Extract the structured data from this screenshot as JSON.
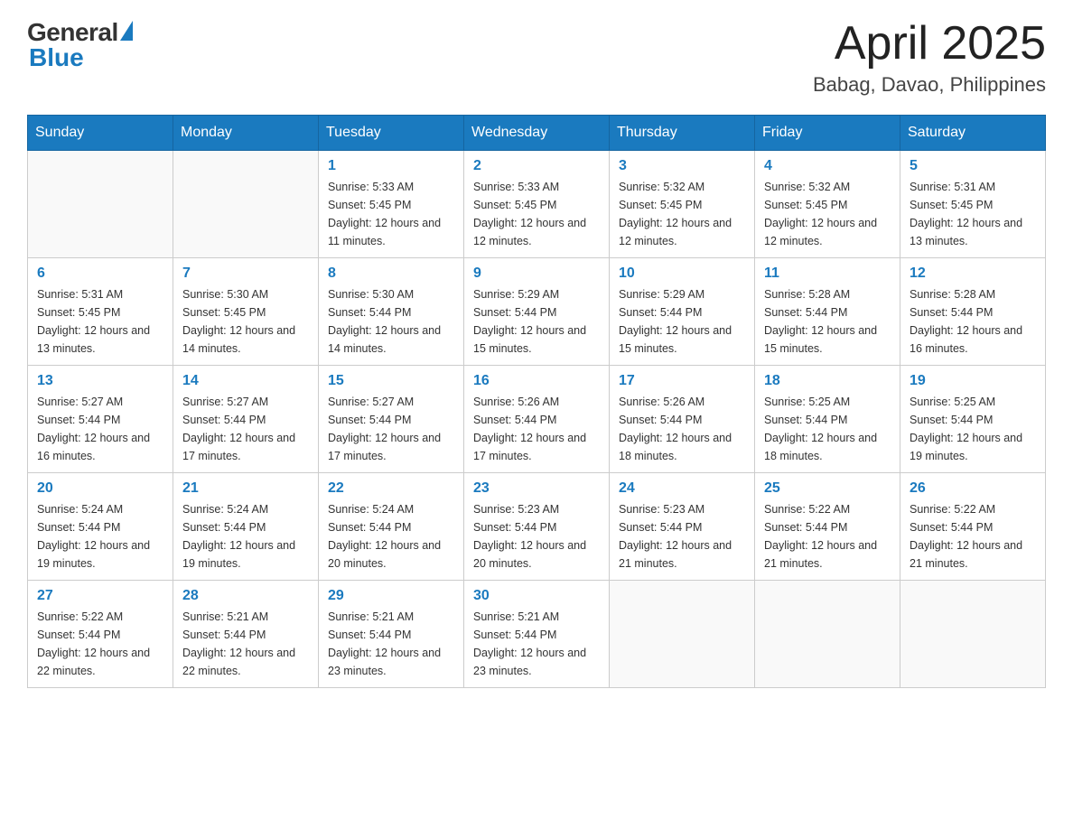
{
  "logo": {
    "general_text": "General",
    "blue_text": "Blue"
  },
  "header": {
    "month_year": "April 2025",
    "location": "Babag, Davao, Philippines"
  },
  "days_of_week": [
    "Sunday",
    "Monday",
    "Tuesday",
    "Wednesday",
    "Thursday",
    "Friday",
    "Saturday"
  ],
  "weeks": [
    [
      {
        "day": "",
        "sunrise": "",
        "sunset": "",
        "daylight": ""
      },
      {
        "day": "",
        "sunrise": "",
        "sunset": "",
        "daylight": ""
      },
      {
        "day": "1",
        "sunrise": "Sunrise: 5:33 AM",
        "sunset": "Sunset: 5:45 PM",
        "daylight": "Daylight: 12 hours and 11 minutes."
      },
      {
        "day": "2",
        "sunrise": "Sunrise: 5:33 AM",
        "sunset": "Sunset: 5:45 PM",
        "daylight": "Daylight: 12 hours and 12 minutes."
      },
      {
        "day": "3",
        "sunrise": "Sunrise: 5:32 AM",
        "sunset": "Sunset: 5:45 PM",
        "daylight": "Daylight: 12 hours and 12 minutes."
      },
      {
        "day": "4",
        "sunrise": "Sunrise: 5:32 AM",
        "sunset": "Sunset: 5:45 PM",
        "daylight": "Daylight: 12 hours and 12 minutes."
      },
      {
        "day": "5",
        "sunrise": "Sunrise: 5:31 AM",
        "sunset": "Sunset: 5:45 PM",
        "daylight": "Daylight: 12 hours and 13 minutes."
      }
    ],
    [
      {
        "day": "6",
        "sunrise": "Sunrise: 5:31 AM",
        "sunset": "Sunset: 5:45 PM",
        "daylight": "Daylight: 12 hours and 13 minutes."
      },
      {
        "day": "7",
        "sunrise": "Sunrise: 5:30 AM",
        "sunset": "Sunset: 5:45 PM",
        "daylight": "Daylight: 12 hours and 14 minutes."
      },
      {
        "day": "8",
        "sunrise": "Sunrise: 5:30 AM",
        "sunset": "Sunset: 5:44 PM",
        "daylight": "Daylight: 12 hours and 14 minutes."
      },
      {
        "day": "9",
        "sunrise": "Sunrise: 5:29 AM",
        "sunset": "Sunset: 5:44 PM",
        "daylight": "Daylight: 12 hours and 15 minutes."
      },
      {
        "day": "10",
        "sunrise": "Sunrise: 5:29 AM",
        "sunset": "Sunset: 5:44 PM",
        "daylight": "Daylight: 12 hours and 15 minutes."
      },
      {
        "day": "11",
        "sunrise": "Sunrise: 5:28 AM",
        "sunset": "Sunset: 5:44 PM",
        "daylight": "Daylight: 12 hours and 15 minutes."
      },
      {
        "day": "12",
        "sunrise": "Sunrise: 5:28 AM",
        "sunset": "Sunset: 5:44 PM",
        "daylight": "Daylight: 12 hours and 16 minutes."
      }
    ],
    [
      {
        "day": "13",
        "sunrise": "Sunrise: 5:27 AM",
        "sunset": "Sunset: 5:44 PM",
        "daylight": "Daylight: 12 hours and 16 minutes."
      },
      {
        "day": "14",
        "sunrise": "Sunrise: 5:27 AM",
        "sunset": "Sunset: 5:44 PM",
        "daylight": "Daylight: 12 hours and 17 minutes."
      },
      {
        "day": "15",
        "sunrise": "Sunrise: 5:27 AM",
        "sunset": "Sunset: 5:44 PM",
        "daylight": "Daylight: 12 hours and 17 minutes."
      },
      {
        "day": "16",
        "sunrise": "Sunrise: 5:26 AM",
        "sunset": "Sunset: 5:44 PM",
        "daylight": "Daylight: 12 hours and 17 minutes."
      },
      {
        "day": "17",
        "sunrise": "Sunrise: 5:26 AM",
        "sunset": "Sunset: 5:44 PM",
        "daylight": "Daylight: 12 hours and 18 minutes."
      },
      {
        "day": "18",
        "sunrise": "Sunrise: 5:25 AM",
        "sunset": "Sunset: 5:44 PM",
        "daylight": "Daylight: 12 hours and 18 minutes."
      },
      {
        "day": "19",
        "sunrise": "Sunrise: 5:25 AM",
        "sunset": "Sunset: 5:44 PM",
        "daylight": "Daylight: 12 hours and 19 minutes."
      }
    ],
    [
      {
        "day": "20",
        "sunrise": "Sunrise: 5:24 AM",
        "sunset": "Sunset: 5:44 PM",
        "daylight": "Daylight: 12 hours and 19 minutes."
      },
      {
        "day": "21",
        "sunrise": "Sunrise: 5:24 AM",
        "sunset": "Sunset: 5:44 PM",
        "daylight": "Daylight: 12 hours and 19 minutes."
      },
      {
        "day": "22",
        "sunrise": "Sunrise: 5:24 AM",
        "sunset": "Sunset: 5:44 PM",
        "daylight": "Daylight: 12 hours and 20 minutes."
      },
      {
        "day": "23",
        "sunrise": "Sunrise: 5:23 AM",
        "sunset": "Sunset: 5:44 PM",
        "daylight": "Daylight: 12 hours and 20 minutes."
      },
      {
        "day": "24",
        "sunrise": "Sunrise: 5:23 AM",
        "sunset": "Sunset: 5:44 PM",
        "daylight": "Daylight: 12 hours and 21 minutes."
      },
      {
        "day": "25",
        "sunrise": "Sunrise: 5:22 AM",
        "sunset": "Sunset: 5:44 PM",
        "daylight": "Daylight: 12 hours and 21 minutes."
      },
      {
        "day": "26",
        "sunrise": "Sunrise: 5:22 AM",
        "sunset": "Sunset: 5:44 PM",
        "daylight": "Daylight: 12 hours and 21 minutes."
      }
    ],
    [
      {
        "day": "27",
        "sunrise": "Sunrise: 5:22 AM",
        "sunset": "Sunset: 5:44 PM",
        "daylight": "Daylight: 12 hours and 22 minutes."
      },
      {
        "day": "28",
        "sunrise": "Sunrise: 5:21 AM",
        "sunset": "Sunset: 5:44 PM",
        "daylight": "Daylight: 12 hours and 22 minutes."
      },
      {
        "day": "29",
        "sunrise": "Sunrise: 5:21 AM",
        "sunset": "Sunset: 5:44 PM",
        "daylight": "Daylight: 12 hours and 23 minutes."
      },
      {
        "day": "30",
        "sunrise": "Sunrise: 5:21 AM",
        "sunset": "Sunset: 5:44 PM",
        "daylight": "Daylight: 12 hours and 23 minutes."
      },
      {
        "day": "",
        "sunrise": "",
        "sunset": "",
        "daylight": ""
      },
      {
        "day": "",
        "sunrise": "",
        "sunset": "",
        "daylight": ""
      },
      {
        "day": "",
        "sunrise": "",
        "sunset": "",
        "daylight": ""
      }
    ]
  ]
}
